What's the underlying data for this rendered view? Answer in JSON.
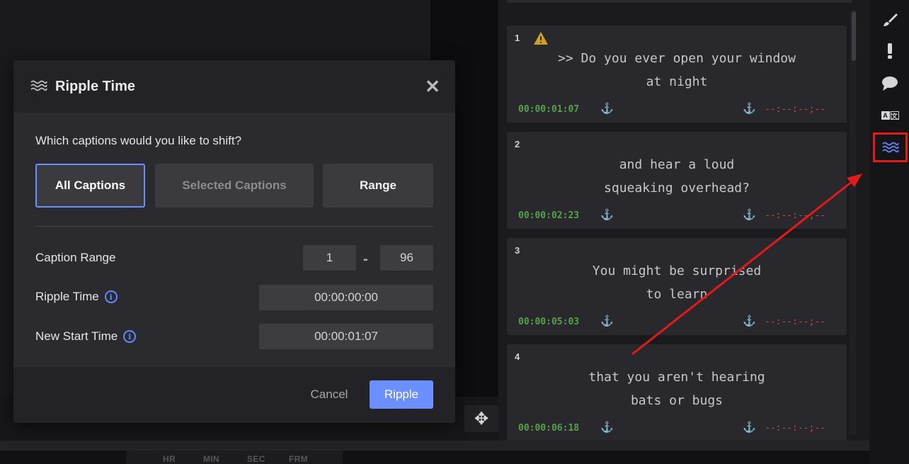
{
  "dialog": {
    "title": "Ripple Time",
    "question": "Which captions would you like to shift?",
    "options": [
      "All Captions",
      "Selected Captions",
      "Range"
    ],
    "selected_option": "All Captions",
    "caption_range": {
      "label": "Caption Range",
      "from": "1",
      "separator": "-",
      "to": "96"
    },
    "ripple_time": {
      "label": "Ripple Time",
      "value": "00:00:00:00"
    },
    "new_start_time": {
      "label": "New Start Time",
      "value": "00:00:01:07"
    },
    "cancel_label": "Cancel",
    "ripple_label": "Ripple"
  },
  "captions": [
    {
      "number": "1",
      "text": ">> Do you ever open your window\nat night",
      "start": "00:00:01:07",
      "end": "--:--:--;--",
      "warning": true
    },
    {
      "number": "2",
      "text": "and hear a loud\nsqueaking overhead?",
      "start": "00:00:02:23",
      "end": "--:--:--;--",
      "warning": false
    },
    {
      "number": "3",
      "text": "You might be surprised\nto learn",
      "start": "00:00:05:03",
      "end": "--:--:--;--",
      "warning": false
    },
    {
      "number": "4",
      "text": "that you aren't hearing\nbats or bugs",
      "start": "00:00:06:18",
      "end": "--:--:--;--",
      "warning": false
    }
  ],
  "timecode_labels": [
    "HR",
    "MIN",
    "SEC",
    "FRM"
  ],
  "toolbar": {
    "items": [
      "brush-icon",
      "alert-icon",
      "comment-icon",
      "translate-icon",
      "ripple-icon"
    ],
    "active_item": "ripple-icon"
  },
  "colors": {
    "accent": "#6b8fff",
    "start_time": "#55a24a",
    "end_time": "#c44a4a",
    "warning": "#d4a017",
    "annotation": "#e11a1a"
  }
}
